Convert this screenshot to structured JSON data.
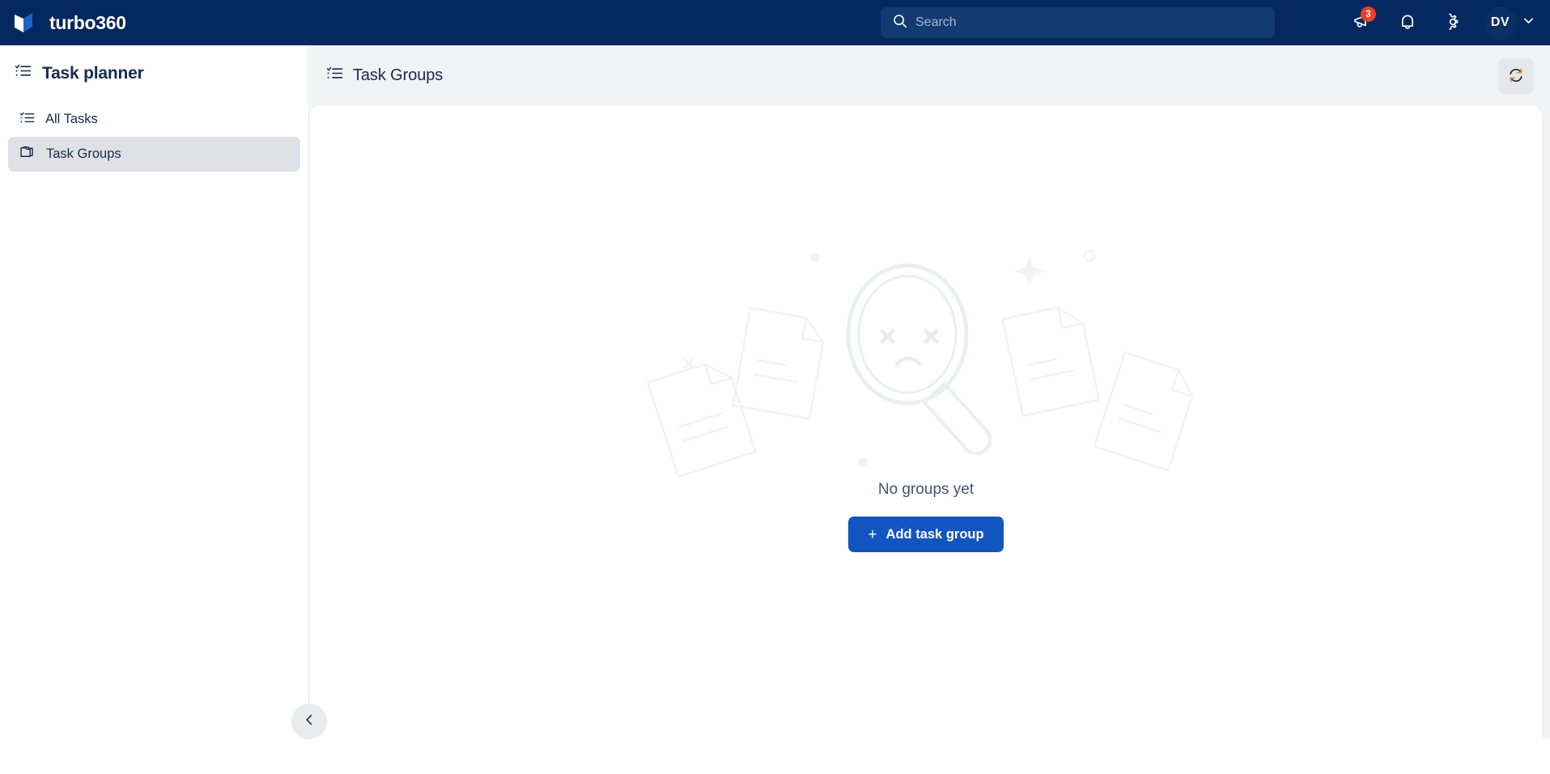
{
  "navbar": {
    "brand_name": "turbo360",
    "brand_color": "#04285f",
    "logo_icon": "turbo360-chevron-logo",
    "search": {
      "placeholder": "Search",
      "value": "",
      "icon": "search-icon"
    },
    "actions": [
      {
        "icon": "megaphone-icon",
        "badge": "3",
        "badge_color": "#e8402a"
      },
      {
        "icon": "bell-icon",
        "badge": ""
      },
      {
        "icon": "gear-icon",
        "badge": ""
      }
    ],
    "avatar": {
      "initials": "DV",
      "chevron_icon": "chevron-down-icon"
    }
  },
  "sidebar": {
    "title": "Task planner",
    "title_icon": "list-check-icon",
    "items": [
      {
        "label": "All Tasks",
        "icon": "list-check-icon",
        "selected": false
      },
      {
        "label": "Task Groups",
        "icon": "folder-icon",
        "selected": true
      }
    ],
    "collapse_icon": "chevron-left-icon",
    "selected_bg": "#dfe1e6"
  },
  "main": {
    "page_title": "Task Groups",
    "page_title_icon": "list-check-icon",
    "refresh_icon": "refresh-icon",
    "background": "#f1f2f4",
    "empty_state": {
      "illustration": "sad-magnifier-with-documents-illustration",
      "message": "No groups yet",
      "action_label": "Add task group",
      "action_icon": "plus-icon",
      "action_color": "#1355c0"
    }
  }
}
